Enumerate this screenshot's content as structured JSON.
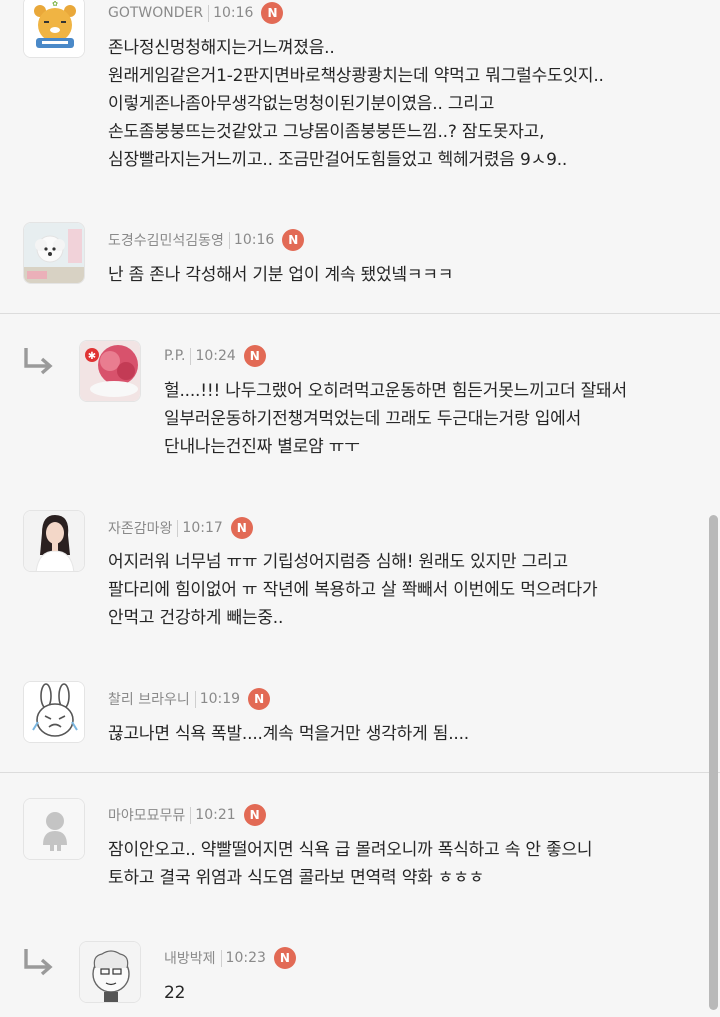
{
  "comments": [
    {
      "nick": "GOTWONDER",
      "time": "10:16",
      "badge": "N",
      "avatar": "ryan-character-avatar",
      "lines": [
        "존나정신멍청해지는거느껴졌음..",
        "원래게임같은거1-2판지면바로책상쾅쾅치는데 약먹고 뭐그럴수도잇지..",
        "이렇게존나좀아무생각없는멍청이된기분이였음.. 그리고",
        "손도좀붕붕뜨는것같았고 그냥몸이좀붕붕뜬느낌..? 잠도못자고,",
        "심장빨라지는거느끼고.. 조금만걸어도힘들었고 헥헤거렸음 9ㅅ9.."
      ]
    },
    {
      "nick": "도경수김민석김동영",
      "time": "10:16",
      "badge": "N",
      "avatar": "white-dog-avatar",
      "lines": [
        "난 좀 존나 각성해서 기분 업이 계속 됐었넼ㅋㅋㅋ"
      ]
    },
    {
      "nick": "P.P.",
      "time": "10:24",
      "badge": "N",
      "avatar": "shaved-ice-avatar",
      "reply": true,
      "lines": [
        "헐....!!! 나두그랬어 오히려먹고운동하면 힘든거못느끼고더 잘돼서",
        "일부러운동하기전챙겨먹었는데 끄래도 두근대는거랑 입에서",
        "단내나는건진짜 별로얌 ㅠㅜ"
      ]
    },
    {
      "nick": "자존감마왕",
      "time": "10:17",
      "badge": "N",
      "avatar": "woman-photo-avatar",
      "lines": [
        "어지러워 너무넘 ㅠㅠ 기립성어지럼증 심해! 원래도 있지만 그리고",
        "팔다리에 힘이없어 ㅠ 작년에 복용하고 살 쫙빼서 이번에도 먹으려다가",
        "안먹고 건강하게 빼는중.."
      ]
    },
    {
      "nick": "찰리 브라우니",
      "time": "10:19",
      "badge": "N",
      "avatar": "crying-rabbit-avatar",
      "lines": [
        "끊고나면 식욕 폭발....계속 먹을거만 생각하게 됨...."
      ]
    },
    {
      "nick": "마야모묘무뮤",
      "time": "10:21",
      "badge": "N",
      "avatar": "default-profile-avatar",
      "lines": [
        "잠이안오고.. 약빨떨어지면 식욕 급 몰려오니까 폭식하고 속 안 좋으니",
        "토하고 결국 위염과 식도염 콜라보 면역력 약화 ㅎㅎㅎ"
      ]
    },
    {
      "nick": "내방박제",
      "time": "10:23",
      "badge": "N",
      "avatar": "sketch-character-avatar",
      "reply": true,
      "lines": [
        "22"
      ]
    }
  ]
}
